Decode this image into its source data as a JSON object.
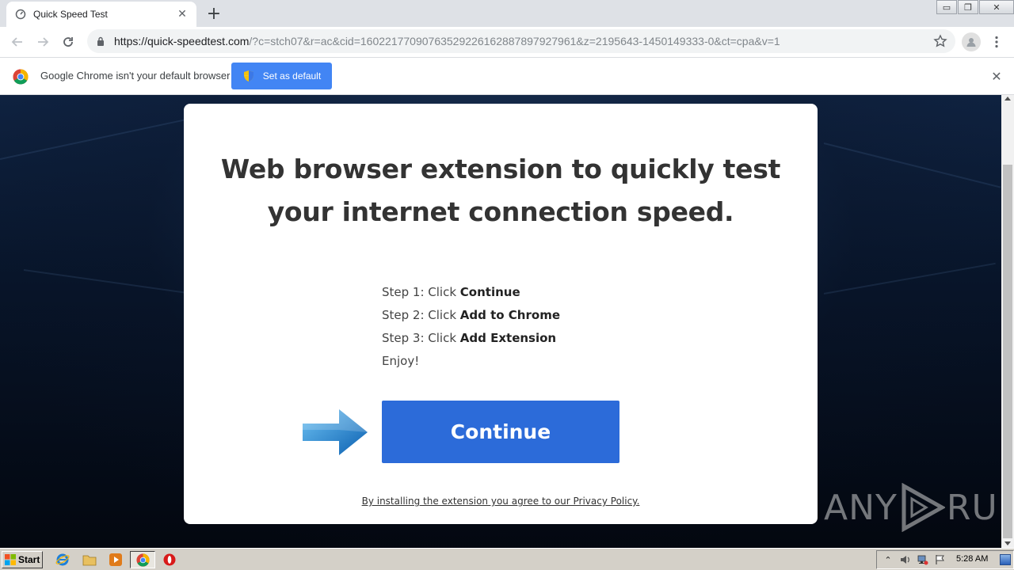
{
  "browser": {
    "tab": {
      "title": "Quick Speed Test",
      "favicon": "speedometer-icon"
    },
    "new_tab_label": "+",
    "url": {
      "host": "https://quick-speedtest.com",
      "path": "/?c=stch07&r=ac&cid=16022177090763529226162887897927961&z=2195643-1450149333-0&ct=cpa&v=1"
    },
    "window_controls": {
      "minimize": "▭",
      "restore": "❐",
      "close": "✕"
    }
  },
  "infobar": {
    "message": "Google Chrome isn't your default browser",
    "button_label": "Set as default",
    "close_label": "✕"
  },
  "page": {
    "headline": "Web browser extension to quickly test your internet connection speed.",
    "steps": [
      {
        "prefix": "Step 1: Click ",
        "action": "Continue"
      },
      {
        "prefix": "Step 2: Click ",
        "action": "Add to Chrome"
      },
      {
        "prefix": "Step 3: Click ",
        "action": "Add Extension"
      },
      {
        "prefix": "Enjoy!",
        "action": ""
      }
    ],
    "cta_label": "Continue",
    "privacy_text": "By installing the extension you agree to our Privacy Policy."
  },
  "watermark": {
    "left": "ANY",
    "right": "RUN"
  },
  "taskbar": {
    "start_label": "Start",
    "clock": "5:28 AM"
  },
  "colors": {
    "cta": "#2c6bd9",
    "infobar_button": "#4285f4"
  }
}
